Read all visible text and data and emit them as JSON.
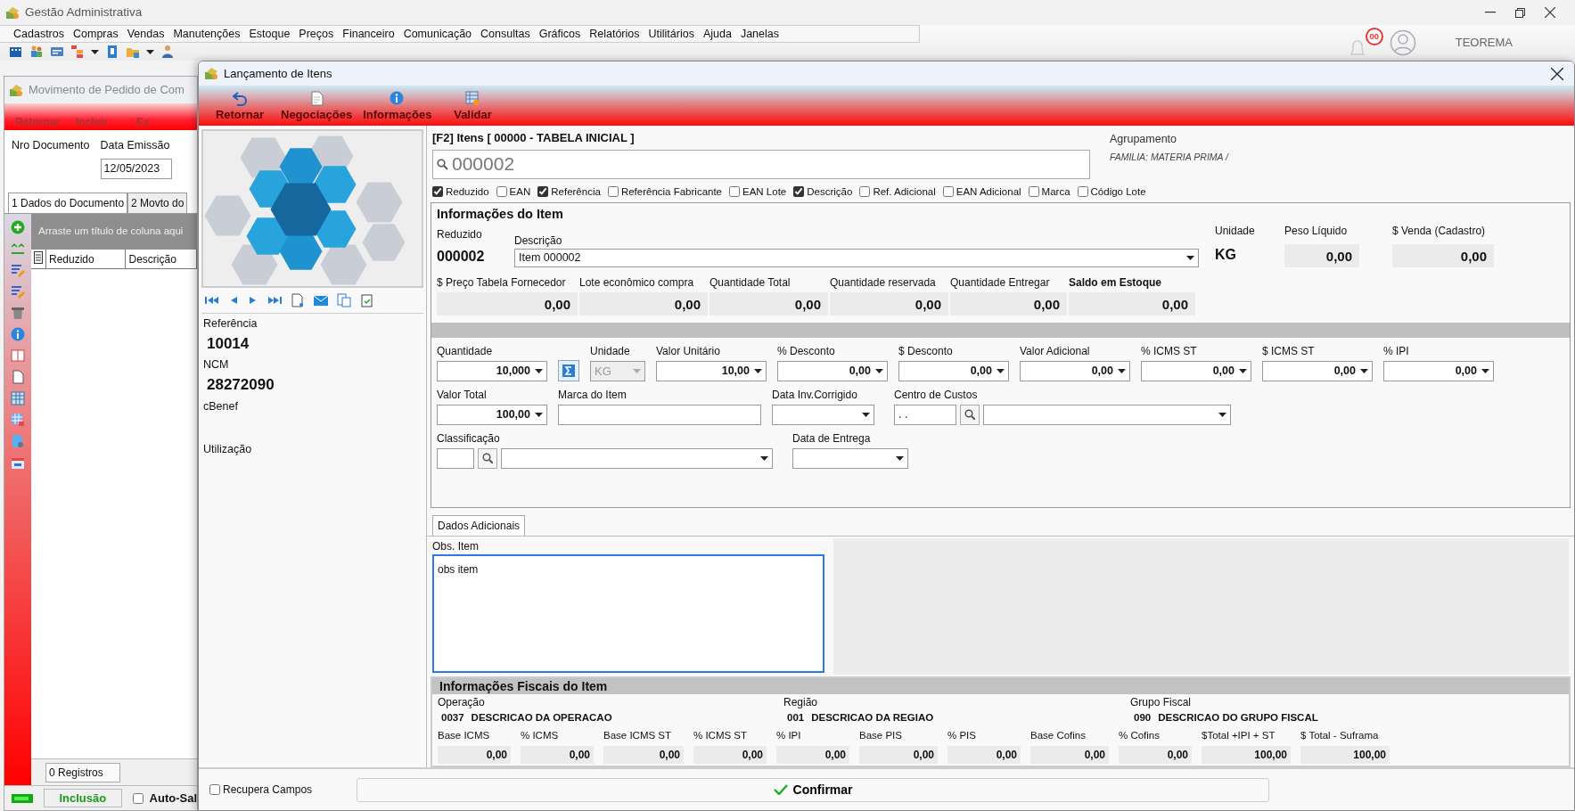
{
  "app": {
    "title": "Gestão Administrativa",
    "menu": [
      "Cadastros",
      "Compras",
      "Vendas",
      "Manutenções",
      "Estoque",
      "Preços",
      "Financeiro",
      "Comunicação",
      "Consultas",
      "Gráficos",
      "Relatórios",
      "Utilitários",
      "Ajuda",
      "Janelas"
    ],
    "notifications": "00",
    "user": "TEOREMA"
  },
  "order_window": {
    "title": "Movimento de Pedido de Com",
    "toolbar": [
      "Retornar",
      "Incluir",
      "Ex"
    ],
    "fields": [
      {
        "label": "Nro Documento"
      },
      {
        "label": "Data Emissão",
        "value": "12/05/2023"
      }
    ],
    "tabs": [
      {
        "label": "1 Dados do Documento",
        "selected": true
      },
      {
        "label": "2 Movto do",
        "selected": false
      }
    ],
    "group_hint": "Arraste um título de coluna aqui",
    "columns": [
      "Reduzido",
      "Descrição"
    ],
    "records": "0 Registros",
    "mode": "Inclusão",
    "autosave": {
      "label": "Auto-Sal",
      "checked": false
    }
  },
  "dialog": {
    "title": "Lançamento de Itens",
    "toolbar": [
      {
        "kind": "undo",
        "label": "Retornar"
      },
      {
        "kind": "document",
        "label": "Negociações"
      },
      {
        "kind": "info",
        "label": "Informações"
      },
      {
        "kind": "validate",
        "label": "Validar"
      }
    ],
    "item_search": {
      "heading": "[F2] Itens [ 00000 - TABELA INICIAL ]",
      "value": "000002",
      "options": [
        {
          "label": "Reduzido",
          "checked": true
        },
        {
          "label": "EAN",
          "checked": false
        },
        {
          "label": "Referência",
          "checked": true
        },
        {
          "label": "Referência Fabricante",
          "checked": false
        },
        {
          "label": "EAN Lote",
          "checked": false
        },
        {
          "label": "Descrição",
          "checked": true
        },
        {
          "label": "Ref. Adicional",
          "checked": false
        },
        {
          "label": "EAN Adicional",
          "checked": false
        },
        {
          "label": "Marca",
          "checked": false
        },
        {
          "label": "Código Lote",
          "checked": false
        }
      ]
    },
    "grouping": {
      "label": "Agrupamento",
      "value": "FAMILIA: MATERIA PRIMA /"
    },
    "details": [
      {
        "label": "Referência",
        "value": "10014"
      },
      {
        "label": "NCM",
        "value": "28272090"
      },
      {
        "label": "cBenef"
      },
      {
        "label": "Utilização"
      }
    ],
    "item_info": {
      "title": "Informações do Item",
      "code": {
        "label": "Reduzido",
        "value": "000002"
      },
      "description": {
        "label": "Descrição",
        "value": "Item 000002"
      },
      "unit": {
        "label": "Unidade",
        "value": "KG"
      },
      "net_weight": {
        "label": "Peso Líquido",
        "value": "0,00"
      },
      "sale_price": {
        "label": "$ Venda (Cadastro)",
        "value": "0,00"
      },
      "totals": [
        {
          "label": "$ Preço Tabela Fornecedor",
          "value": "0,00",
          "bold": false
        },
        {
          "label": "Lote econômico compra",
          "value": "0,00",
          "bold": false
        },
        {
          "label": "Quantidade Total",
          "value": "0,00",
          "bold": false
        },
        {
          "label": "Quantidade reservada",
          "value": "0,00",
          "bold": false
        },
        {
          "label": "Quantidade Entregar",
          "value": "0,00",
          "bold": false
        },
        {
          "label": "Saldo em Estoque",
          "value": "0,00",
          "bold": true
        }
      ]
    },
    "entry_rows": [
      [
        {
          "kind": "combo",
          "label": "Quantidade",
          "value": "10,000"
        },
        {
          "kind": "sigma"
        },
        {
          "kind": "select",
          "label": "Unidade",
          "value": "KG",
          "disabled": true
        },
        {
          "kind": "combo",
          "label": "Valor Unitário",
          "value": "10,00"
        },
        {
          "kind": "combo",
          "label": "% Desconto",
          "value": "0,00"
        },
        {
          "kind": "combo",
          "label": "$ Desconto",
          "value": "0,00"
        },
        {
          "kind": "combo",
          "label": "Valor Adicional",
          "value": "0,00"
        },
        {
          "kind": "combo",
          "label": "% ICMS ST",
          "value": "0,00"
        },
        {
          "kind": "combo",
          "label": "$ ICMS ST",
          "value": "0,00"
        },
        {
          "kind": "combo",
          "label": "% IPI",
          "value": "0,00"
        }
      ],
      [
        {
          "kind": "combo",
          "label": "Valor Total",
          "value": "100,00"
        },
        {
          "kind": "text",
          "label": "Marca do Item"
        },
        {
          "kind": "combo",
          "label": "Data Inv.Corrigido"
        },
        {
          "kind": "lookup",
          "label": "Centro de Custos",
          "value": ".  ."
        }
      ],
      [
        {
          "kind": "lookup",
          "label": "Classificação"
        },
        {
          "kind": "combo",
          "label": "Data de Entrega"
        }
      ]
    ],
    "extra_tabs": [
      {
        "label": "Dados Adicionais",
        "selected": true
      }
    ],
    "notes": {
      "label": "Obs. Item",
      "value": "obs item"
    },
    "fiscal": {
      "title": "Informações Fiscais do Item",
      "groups": [
        {
          "label": "Operação",
          "code": "0037",
          "name": "DESCRICAO DA OPERACAO"
        },
        {
          "label": "Região",
          "code": "001",
          "name": "DESCRICAO DA REGIAO"
        },
        {
          "label": "Grupo Fiscal",
          "code": "090",
          "name": "DESCRICAO DO GRUPO FISCAL"
        }
      ],
      "values": [
        {
          "label": "Base ICMS",
          "value": "0,00"
        },
        {
          "label": "% ICMS",
          "value": "0,00"
        },
        {
          "label": "Base ICMS ST",
          "value": "0,00"
        },
        {
          "label": "% ICMS ST",
          "value": "0,00"
        },
        {
          "label": "% IPI",
          "value": "0,00"
        },
        {
          "label": "Base PIS",
          "value": "0,00"
        },
        {
          "label": "% PIS",
          "value": "0,00"
        },
        {
          "label": "Base Cofins",
          "value": "0,00"
        },
        {
          "label": "% Cofins",
          "value": "0,00"
        },
        {
          "label": "$Total +IPI + ST",
          "value": "100,00"
        },
        {
          "label": "$ Total - Suframa",
          "value": "100,00"
        }
      ]
    },
    "recover_fields": {
      "label": "Recupera Campos",
      "checked": false
    },
    "confirm": "Confirmar"
  }
}
